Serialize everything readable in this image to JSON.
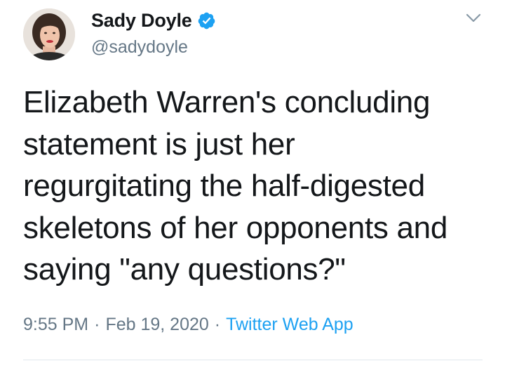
{
  "author": {
    "display_name": "Sady Doyle",
    "handle": "@sadydoyle",
    "verified": true,
    "avatar_icon": "profile-photo"
  },
  "tweet": {
    "text": "Elizabeth Warren's concluding\nstatement is just her\nregurgitating the half-digested\nskeletons of her opponents and\nsaying \"any questions?\""
  },
  "meta": {
    "time": "9:55 PM",
    "separator": "·",
    "date": "Feb 19, 2020",
    "source": "Twitter Web App"
  },
  "colors": {
    "accent": "#1da1f2",
    "secondary_text": "#657786",
    "primary_text": "#14171a"
  },
  "icons": {
    "verified": "verified-badge-icon",
    "menu": "chevron-down-icon"
  }
}
